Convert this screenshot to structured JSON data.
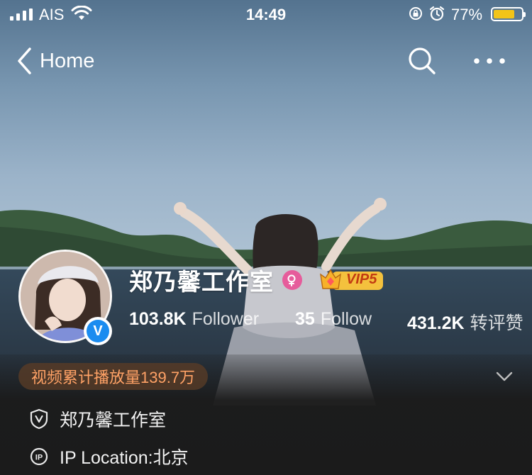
{
  "status_bar": {
    "carrier": "AIS",
    "time": "14:49",
    "battery_percent": "77%",
    "battery_level": 0.77,
    "icons": [
      "signal-icon",
      "wifi-icon",
      "rotation-lock-icon",
      "alarm-icon",
      "battery-icon"
    ]
  },
  "nav": {
    "back_label": "Home",
    "icons": [
      "back-chevron-icon",
      "search-icon",
      "more-icon"
    ]
  },
  "profile": {
    "name": "郑乃馨工作室",
    "vip_label": "VIP5",
    "verified_icon": "verified-v-icon",
    "gender_icon": "female-icon",
    "stats": [
      {
        "value": "103.8K",
        "label": "Follower"
      },
      {
        "value": "35",
        "label": "Follow"
      },
      {
        "value": "431.2K",
        "label": "转评赞"
      }
    ]
  },
  "info": {
    "plays_text": "视频累计播放量139.7万",
    "verified_name": "郑乃馨工作室",
    "ip_location": "IP Location:北京"
  },
  "colors": {
    "accent_orange": "#ffa266",
    "vip_gold": "#f4c13d",
    "verify_blue": "#1a8cf0",
    "gender_pink": "#e65c9b",
    "battery_yellow": "#f2c418"
  }
}
